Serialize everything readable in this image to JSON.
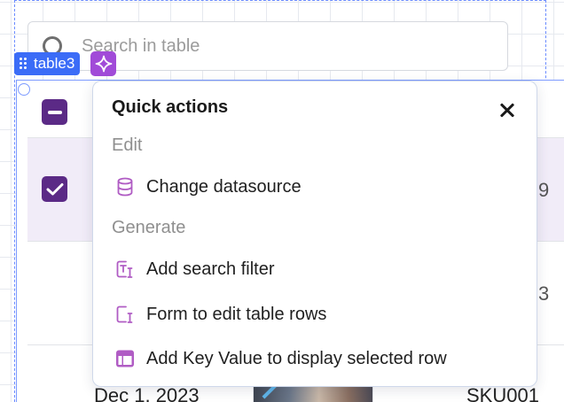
{
  "search": {
    "placeholder": "Search in table"
  },
  "widget": {
    "name": "table3"
  },
  "table": {
    "visible_fragments": {
      "row1_right": "9",
      "row2_right": "3",
      "row3_date": "Dec 1, 2023",
      "row3_sku": "SKU001"
    }
  },
  "quick_actions": {
    "title": "Quick actions",
    "sections": [
      {
        "label": "Edit",
        "items": [
          {
            "label": "Change datasource",
            "icon": "database-icon"
          }
        ]
      },
      {
        "label": "Generate",
        "items": [
          {
            "label": "Add search filter",
            "icon": "text-input-icon"
          },
          {
            "label": "Form to edit table rows",
            "icon": "form-icon"
          },
          {
            "label": "Add Key Value to display selected row",
            "icon": "key-value-table-icon"
          }
        ]
      }
    ]
  },
  "colors": {
    "accent_purple": "#5b2a86",
    "selected_row": "#f1ecf8",
    "widget_tag_blue": "#3b6cf7",
    "ai_button": "#a14bd8",
    "icon_purple": "#b05cc4"
  }
}
